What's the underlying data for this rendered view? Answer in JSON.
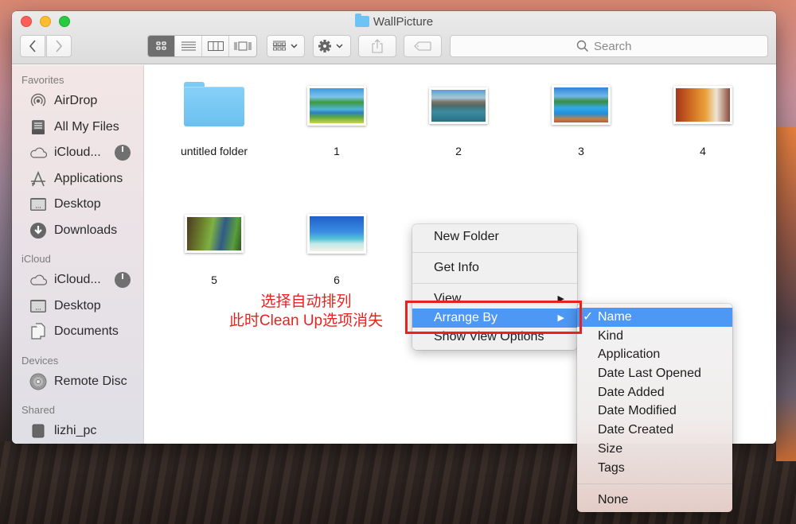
{
  "window": {
    "title": "WallPicture",
    "title_icon": "folder-icon"
  },
  "toolbar": {
    "back": "‹",
    "forward": "›",
    "view_modes": [
      {
        "name": "icon-view",
        "icon": "grid-icon",
        "active": true
      },
      {
        "name": "list-view",
        "icon": "list-icon",
        "active": false
      },
      {
        "name": "column-view",
        "icon": "columns-icon",
        "active": false
      },
      {
        "name": "coverflow-view",
        "icon": "coverflow-icon",
        "active": false
      }
    ],
    "arrange_icon": "arrange-icon",
    "action_icon": "gear-icon",
    "share_icon": "share-icon",
    "tag_icon": "tag-icon",
    "search_placeholder": "Search"
  },
  "sidebar": {
    "sections": [
      {
        "title": "Favorites",
        "items": [
          {
            "label": "AirDrop",
            "icon": "airdrop-icon"
          },
          {
            "label": "All My Files",
            "icon": "all-files-icon"
          },
          {
            "label": "iCloud...",
            "icon": "cloud-icon",
            "badge": "progress-pie"
          },
          {
            "label": "Applications",
            "icon": "applications-icon"
          },
          {
            "label": "Desktop",
            "icon": "desktop-icon"
          },
          {
            "label": "Downloads",
            "icon": "downloads-icon"
          }
        ]
      },
      {
        "title": "iCloud",
        "items": [
          {
            "label": "iCloud...",
            "icon": "cloud-icon",
            "badge": "progress-pie"
          },
          {
            "label": "Desktop",
            "icon": "desktop-icon"
          },
          {
            "label": "Documents",
            "icon": "documents-icon"
          }
        ]
      },
      {
        "title": "Devices",
        "items": [
          {
            "label": "Remote Disc",
            "icon": "disc-icon"
          }
        ]
      },
      {
        "title": "Shared",
        "items": [
          {
            "label": "lizhi_pc",
            "icon": "computer-icon"
          }
        ]
      }
    ]
  },
  "files": [
    {
      "name": "untitled folder",
      "type": "folder"
    },
    {
      "name": "1",
      "type": "image",
      "scene": "lake-meadow"
    },
    {
      "name": "2",
      "type": "image",
      "scene": "mountain-lake"
    },
    {
      "name": "3",
      "type": "image",
      "scene": "infinity-pool"
    },
    {
      "name": "4",
      "type": "image",
      "scene": "autumn-forest"
    },
    {
      "name": "5",
      "type": "image",
      "scene": "river-forest"
    },
    {
      "name": "6",
      "type": "image",
      "scene": "tropical-beach"
    }
  ],
  "context_menu": {
    "items": [
      {
        "label": "New Folder"
      },
      {
        "label": "Get Info"
      },
      {
        "label": "View",
        "submenu": true
      },
      {
        "label": "Arrange By",
        "submenu": true,
        "highlighted": true
      },
      {
        "label": "Show View Options"
      }
    ],
    "submenu_arrow": "▶"
  },
  "arrange_submenu": {
    "items": [
      {
        "label": "Name",
        "checked": true,
        "highlighted": true
      },
      {
        "label": "Kind"
      },
      {
        "label": "Application"
      },
      {
        "label": "Date Last Opened"
      },
      {
        "label": "Date Added"
      },
      {
        "label": "Date Modified"
      },
      {
        "label": "Date Created"
      },
      {
        "label": "Size"
      },
      {
        "label": "Tags"
      },
      {
        "label": "None"
      }
    ],
    "check_mark": "✓"
  },
  "annotation": {
    "line1": "选择自动排列",
    "line2": "此时Clean Up选项消失",
    "color": "#e8231f"
  },
  "colors": {
    "highlight": "#4c98f4",
    "folder": "#6cc0f0"
  }
}
